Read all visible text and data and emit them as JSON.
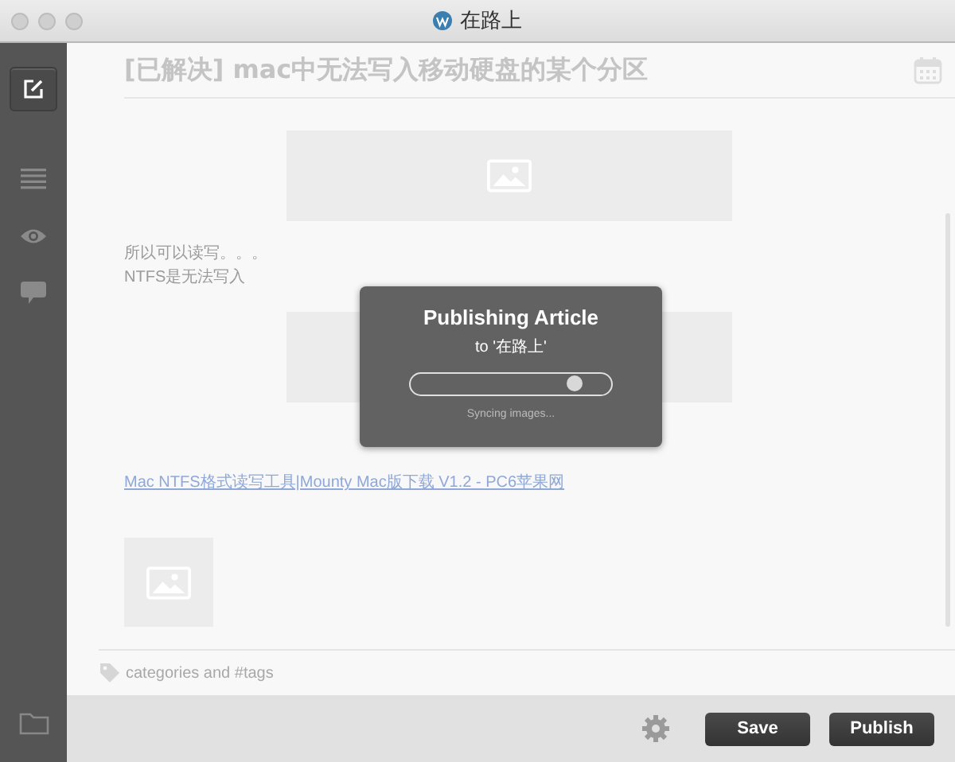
{
  "window": {
    "title": "在路上"
  },
  "sidebar": {
    "items": [
      {
        "kind": "edit",
        "selected": true
      },
      {
        "kind": "list",
        "selected": false
      },
      {
        "kind": "preview",
        "selected": false
      },
      {
        "kind": "comments",
        "selected": false
      }
    ],
    "bottom": {
      "kind": "folder"
    }
  },
  "editor": {
    "title": "[已解决] mac中无法写入移动硬盘的某个分区",
    "blocks": [
      {
        "kind": "banner"
      },
      {
        "kind": "text",
        "lines": [
          "所以可以读写。。。",
          "NTFS是无法写入"
        ]
      },
      {
        "kind": "banner-covered"
      },
      {
        "kind": "link",
        "text": "Mac NTFS格式读写工具|Mounty Mac版下载 V1.2 - PC6苹果网"
      },
      {
        "kind": "thumbnail"
      }
    ],
    "tags": {
      "placeholder": "categories and #tags"
    }
  },
  "dialog": {
    "title": "Publishing Article",
    "subtitle": "to '在路上'",
    "progress": {
      "level": 0.82
    },
    "status": "Syncing images..."
  },
  "footer": {
    "buttons": [
      "Save",
      "Publish"
    ]
  }
}
